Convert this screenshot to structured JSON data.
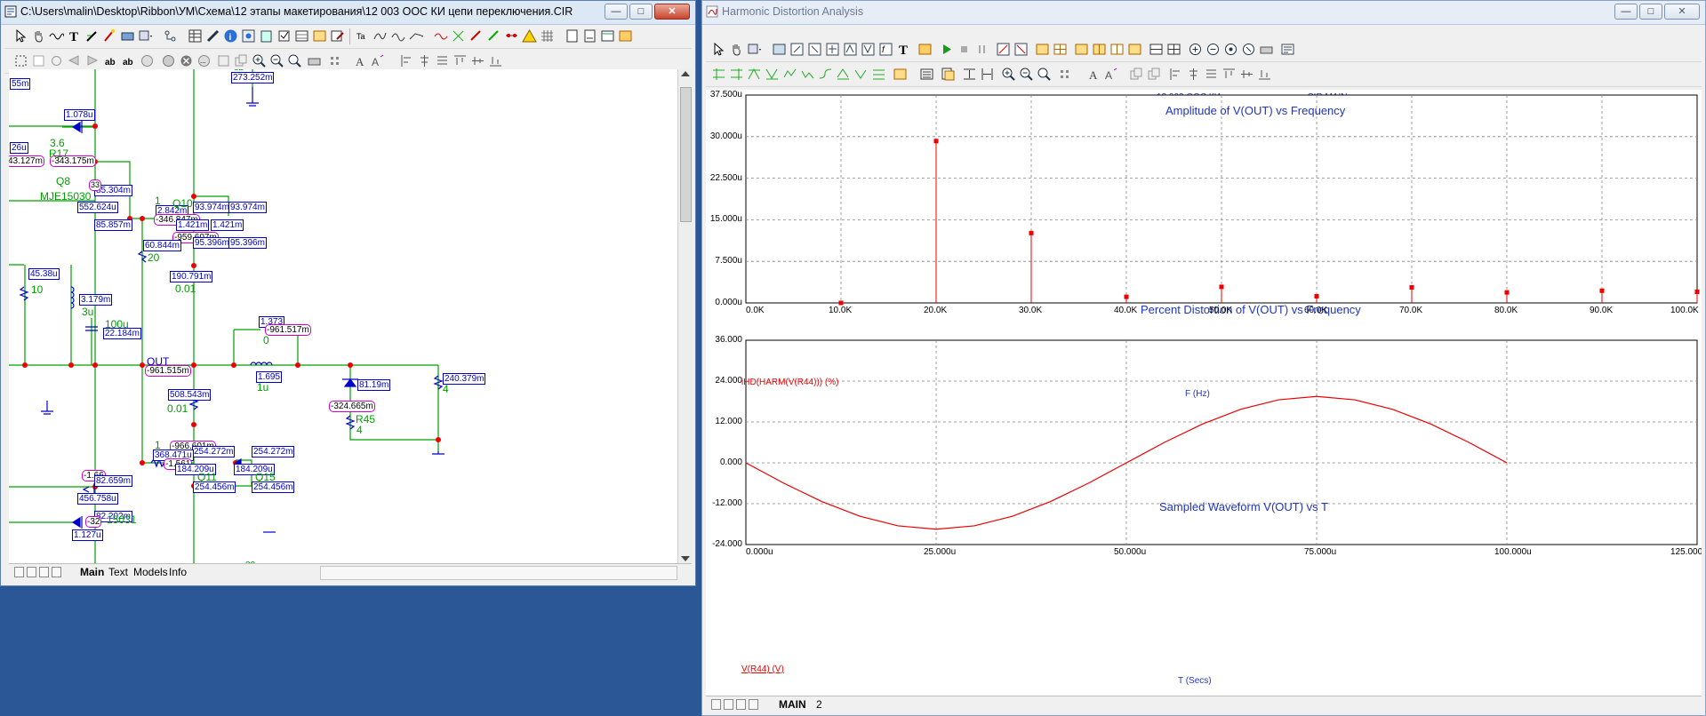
{
  "left_window": {
    "title": "C:\\Users\\malin\\Desktop\\Ribbon\\УМ\\Схема\\12 этапы макетирования\\12 003 ООС КИ цепи переключения.CIR",
    "tabs": [
      "Main",
      "Text",
      "Models",
      "Info"
    ],
    "active_tab": "Main",
    "value_labels": [
      {
        "text": "55m",
        "kind": "blue"
      },
      {
        "text": "1.078u",
        "kind": "blue"
      },
      {
        "text": "26u",
        "kind": "blue"
      },
      {
        "text": "43.127m",
        "kind": "mag"
      },
      {
        "text": "-343.175m",
        "kind": "mag"
      },
      {
        "text": "85.304m",
        "kind": "blue"
      },
      {
        "text": "33",
        "kind": "mag"
      },
      {
        "text": "552.624u",
        "kind": "blue"
      },
      {
        "text": "85.857m",
        "kind": "blue"
      },
      {
        "text": "2.842m",
        "kind": "blue"
      },
      {
        "text": "-346.847m",
        "kind": "mag"
      },
      {
        "text": "93.974m",
        "kind": "blue"
      },
      {
        "text": "93.974m",
        "kind": "blue"
      },
      {
        "text": "1.421m",
        "kind": "blue"
      },
      {
        "text": "1.421m",
        "kind": "blue"
      },
      {
        "text": "-959.607m",
        "kind": "mag"
      },
      {
        "text": "95.396m",
        "kind": "blue"
      },
      {
        "text": "95.396m",
        "kind": "blue"
      },
      {
        "text": "60.844m",
        "kind": "blue"
      },
      {
        "text": "190.791m",
        "kind": "blue"
      },
      {
        "text": "45.38u",
        "kind": "blue"
      },
      {
        "text": "3.179m",
        "kind": "blue"
      },
      {
        "text": "22.184m",
        "kind": "blue"
      },
      {
        "text": "1.373",
        "kind": "blue"
      },
      {
        "text": "-961.517m",
        "kind": "mag"
      },
      {
        "text": "-961.515m",
        "kind": "mag"
      },
      {
        "text": "1.695",
        "kind": "blue"
      },
      {
        "text": "240.379m",
        "kind": "blue"
      },
      {
        "text": "508.543m",
        "kind": "blue"
      },
      {
        "text": "81.19m",
        "kind": "blue"
      },
      {
        "text": "-324.665m",
        "kind": "mag"
      },
      {
        "text": "-966.601m",
        "kind": "mag"
      },
      {
        "text": "254.272m",
        "kind": "blue"
      },
      {
        "text": "254.272m",
        "kind": "blue"
      },
      {
        "text": "368.471u",
        "kind": "blue"
      },
      {
        "text": "-1.561",
        "kind": "mag"
      },
      {
        "text": "184.209u",
        "kind": "blue"
      },
      {
        "text": "184.209u",
        "kind": "blue"
      },
      {
        "text": "254.456m",
        "kind": "blue"
      },
      {
        "text": "254.456m",
        "kind": "blue"
      },
      {
        "text": "-1.66",
        "kind": "mag"
      },
      {
        "text": "82.659m",
        "kind": "blue"
      },
      {
        "text": "456.758u",
        "kind": "blue"
      },
      {
        "text": "82.202m",
        "kind": "blue"
      },
      {
        "text": "-32",
        "kind": "mag"
      },
      {
        "text": "1.127u",
        "kind": "blue"
      },
      {
        "text": "273.252m",
        "kind": "blue"
      }
    ],
    "component_labels": [
      "3.6",
      "R17",
      "Q8",
      "MJE15030",
      "1",
      "Q10",
      "20",
      "0.01",
      "10",
      "3u",
      "100u",
      "0",
      "1u",
      "4",
      "R45",
      "4",
      "0.01",
      "1",
      "Q11",
      "Q15",
      "15031",
      "32",
      "32"
    ],
    "node_label": "OUT"
  },
  "right_window": {
    "title": "Harmonic Distortion Analysis",
    "tabs": [
      "MAIN",
      "2"
    ],
    "active_tab": "MAIN",
    "header_text": "12 003 ООС КИ цепи переключения.CIR MAIN"
  },
  "chart_data": [
    {
      "type": "bar",
      "title": "Amplitude of V(OUT) vs Frequency",
      "subtitle": "Percent Distortion of V(OUT) vs Frequency",
      "xlabel": "F (Hz)",
      "ylabel": "iHD(HARM(V(R44))) (%)",
      "x_tick_labels": [
        "0.0K",
        "10.0K",
        "20.0K",
        "30.0K",
        "40.0K",
        "50.0K",
        "60.0K",
        "70.0K",
        "80.0K",
        "90.0K",
        "100.0K"
      ],
      "y_tick_labels": [
        "0.000u",
        "7.500u",
        "15.000u",
        "22.500u",
        "30.000u",
        "37.500u"
      ],
      "xlim": [
        0,
        100000
      ],
      "ylim": [
        0,
        37.5
      ],
      "x": [
        10000,
        20000,
        30000,
        40000,
        50000,
        60000,
        70000,
        80000,
        90000,
        100000
      ],
      "values": [
        0,
        29.2,
        12.6,
        1.1,
        2.9,
        1.2,
        2.8,
        1.9,
        2.2,
        2.0
      ],
      "color": "#ee0000",
      "grid": true
    },
    {
      "type": "line",
      "title": "Sampled Waveform  V(OUT) vs T",
      "xlabel": "T (Secs)",
      "ylabel": "V(R44) (V)",
      "x_tick_labels": [
        "0.000u",
        "25.000u",
        "50.000u",
        "75.000u",
        "100.000u",
        "125.000u"
      ],
      "y_tick_labels": [
        "-24.000",
        "-12.000",
        "0.000",
        "12.000",
        "24.000",
        "36.000"
      ],
      "xlim": [
        0,
        125
      ],
      "ylim": [
        -24,
        36
      ],
      "x": [
        0,
        5,
        10,
        15,
        20,
        25,
        30,
        35,
        40,
        45,
        50,
        55,
        60,
        65,
        70,
        75,
        80,
        85,
        90,
        95,
        100
      ],
      "y": [
        0,
        -6.0,
        -11.4,
        -15.7,
        -18.5,
        -19.5,
        -18.5,
        -15.7,
        -11.4,
        -6.0,
        0,
        6.0,
        11.4,
        15.7,
        18.5,
        19.5,
        18.5,
        15.7,
        11.4,
        6.0,
        0
      ],
      "color": "#ee0000",
      "grid": true
    }
  ]
}
